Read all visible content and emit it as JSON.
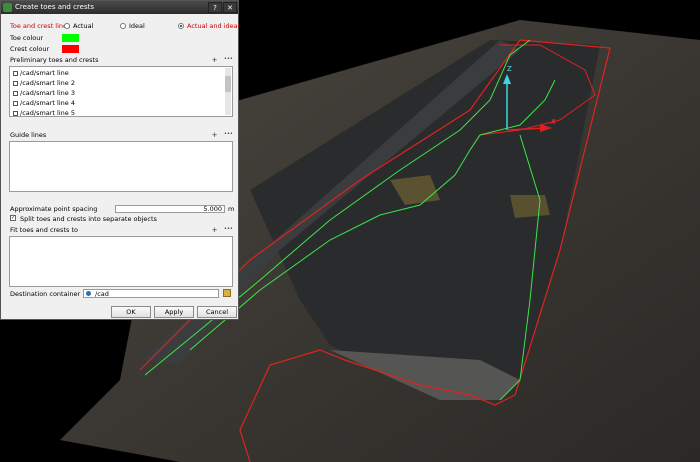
{
  "dialog": {
    "title": "Create toes and crests",
    "help_label": "?",
    "close_label": "✕",
    "toe_crest_label": "Toe and crest lines",
    "options": {
      "actual": "Actual",
      "ideal": "Ideal",
      "actual_and_ideal": "Actual and ideal"
    },
    "toe_colour_label": "Toe colour",
    "crest_colour_label": "Crest colour",
    "toe_colour": "#00ff00",
    "crest_colour": "#ff0000",
    "preliminary_label": "Preliminary toes and crests",
    "preliminary_items": [
      "/cad/smart line",
      "/cad/smart line 2",
      "/cad/smart line 3",
      "/cad/smart line 4",
      "/cad/smart line 5"
    ],
    "guide_lines_label": "Guide lines",
    "point_spacing_label": "Approximate point spacing",
    "point_spacing_value": "5.000",
    "point_spacing_unit": "m",
    "split_check_mark": "✓",
    "split_label": "Split toes and crests into separate objects",
    "fit_label": "Fit toes and crests to",
    "destination_label": "Destination container",
    "destination_value": "/cad",
    "add_glyph": "+",
    "more_glyph": "•••",
    "buttons": {
      "ok": "OK",
      "apply": "Apply",
      "cancel": "Cancel"
    }
  },
  "viewport": {
    "axis_z": "Z",
    "axis_x": "X"
  }
}
